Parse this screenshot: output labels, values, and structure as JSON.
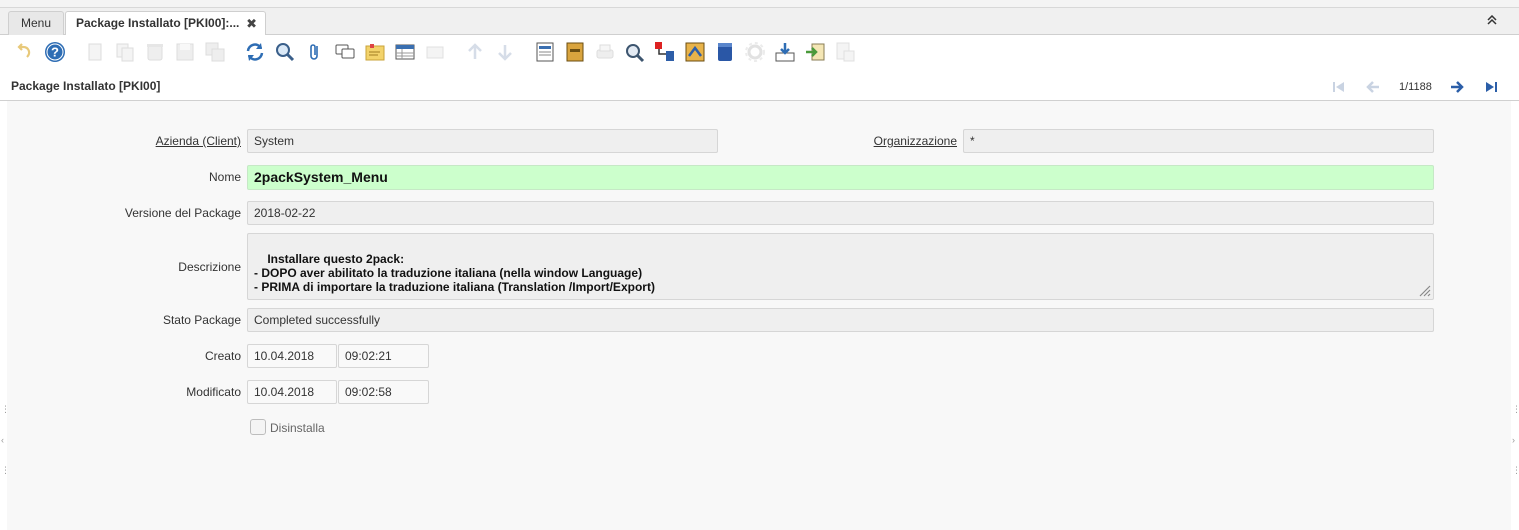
{
  "tabs": {
    "menu_label": "Menu",
    "active_label": "Package Installato [PKI00]:...",
    "close_glyph": "✖"
  },
  "collapse_glyph": "⌃",
  "toolbar": {
    "icons": [
      "undo-icon",
      "help-icon",
      "new-record-icon",
      "copy-record-icon",
      "delete-icon",
      "save-icon",
      "save-and-new-icon",
      "refresh-icon",
      "find-icon",
      "attachment-icon",
      "chat-icon",
      "post-it-icon",
      "grid-toggle-icon",
      "multi-delete-icon",
      "previous-record-icon",
      "next-record-icon",
      "report-icon",
      "archive-icon",
      "print-icon",
      "zoom-across-icon",
      "workflow-icon",
      "request-icon",
      "product-info-icon",
      "process-icon",
      "export-icon",
      "import-icon",
      "quick-form-icon"
    ]
  },
  "window": {
    "title": "Package Installato [PKI00]",
    "record_count": "1/1188"
  },
  "form": {
    "client_label": "Azienda (Client)",
    "client_value": "System",
    "org_label": "Organizzazione",
    "org_value": "*",
    "name_label": "Nome",
    "name_value": "2packSystem_Menu",
    "version_label": "Versione del Package",
    "version_value": "2018-02-22",
    "description_label": "Descrizione",
    "description_value": "Installare questo 2pack:\n- DOPO aver abilitato la traduzione italiana (nella window Language)\n- PRIMA di importare la traduzione italiana (Translation /Import/Export)",
    "status_label": "Stato Package",
    "status_value": "Completed successfully",
    "created_label": "Creato",
    "created_date": "10.04.2018",
    "created_time": "09:02:21",
    "updated_label": "Modificato",
    "updated_date": "10.04.2018",
    "updated_time": "09:02:58",
    "uninstall_label": "Disinstalla",
    "uninstall_checked": false
  },
  "colors": {
    "mandatory_bg": "#ccffcc",
    "nav_blue": "#2b5ea8"
  }
}
